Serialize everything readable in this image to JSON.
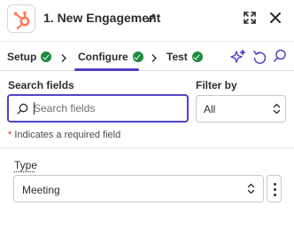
{
  "header": {
    "title": "1. New Engagement",
    "app_logo": "hubspot-logo-icon",
    "icons": [
      "pencil-icon",
      "expand-icon",
      "close-icon"
    ],
    "brand_color": "#ff7a59"
  },
  "tabs": {
    "items": [
      {
        "label": "Setup",
        "status": "complete"
      },
      {
        "label": "Configure",
        "status": "complete",
        "active": true
      },
      {
        "label": "Test",
        "status": "complete"
      }
    ],
    "tools": [
      "sparkle-icon",
      "undo-icon",
      "search-icon"
    ],
    "active_color": "#503ebd",
    "check_color": "#1c8b3c"
  },
  "search": {
    "label": "Search fields",
    "placeholder": "Search fields",
    "value": ""
  },
  "filter": {
    "label": "Filter by",
    "value": "All"
  },
  "required_note": {
    "star": "*",
    "text": "Indicates a required field"
  },
  "fields": {
    "type": {
      "label": "Type",
      "value": "Meeting"
    }
  }
}
